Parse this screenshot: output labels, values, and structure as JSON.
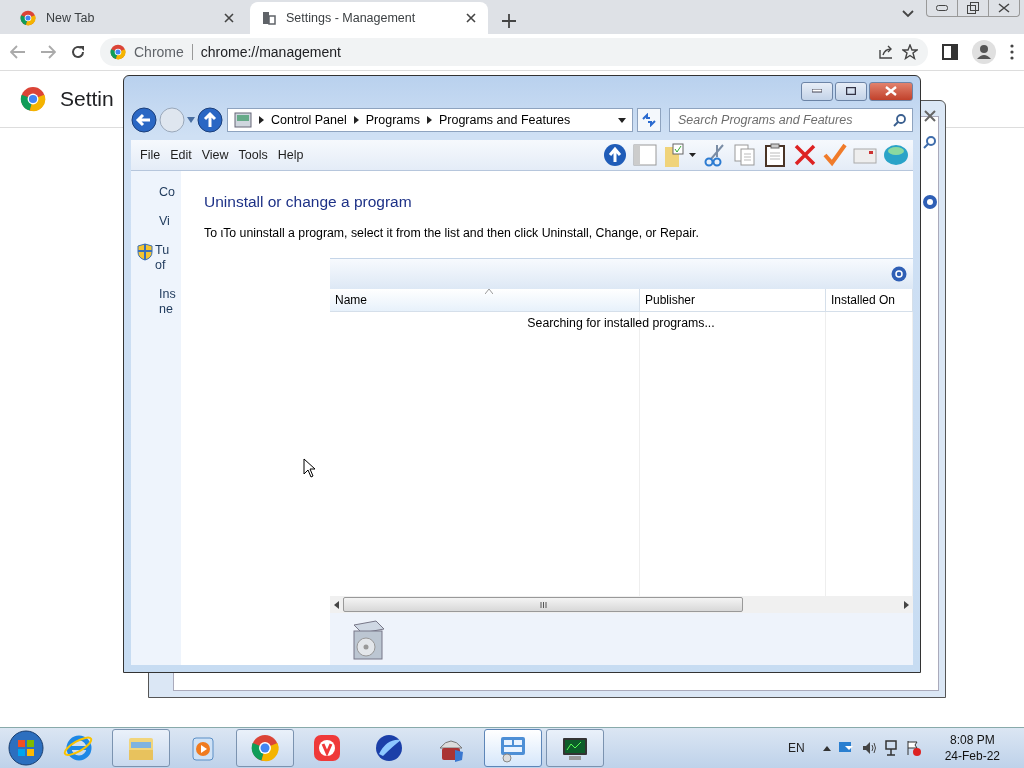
{
  "browser": {
    "tabs": [
      {
        "title": "New Tab",
        "selected": false
      },
      {
        "title": "Settings - Management",
        "selected": true
      }
    ],
    "omnibox": {
      "site": "Chrome",
      "url": "chrome://management"
    },
    "page_heading": "Settin"
  },
  "explorer": {
    "breadcrumb": [
      "Control Panel",
      "Programs",
      "Programs and Features"
    ],
    "search": {
      "placeholder": "Search Programs and Features"
    },
    "menu": [
      "File",
      "Edit",
      "View",
      "Tools",
      "Help"
    ],
    "sidebar": [
      {
        "kind": "link",
        "lines": [
          "Co"
        ]
      },
      {
        "kind": "link",
        "lines": [
          "Vi"
        ]
      },
      {
        "kind": "shield",
        "lines": [
          "Tu",
          "of"
        ]
      },
      {
        "kind": "link",
        "lines": [
          "Ins",
          "ne"
        ]
      }
    ],
    "heading": "Uninstall or change a program",
    "description": "To ιTo uninstall a program, select it from the list and then click Uninstall, Change, or Repair.",
    "columns": [
      "Name",
      "Publisher",
      "Installed On"
    ],
    "status": "Searching for installed programs..."
  },
  "taskbar": {
    "apps": [
      {
        "kind": "ie",
        "running": false,
        "selected": false
      },
      {
        "kind": "folder",
        "running": true,
        "selected": false
      },
      {
        "kind": "media",
        "running": false,
        "selected": false
      },
      {
        "kind": "chrome",
        "running": true,
        "selected": false
      },
      {
        "kind": "vivaldi",
        "running": false,
        "selected": false
      },
      {
        "kind": "bird",
        "running": false,
        "selected": false
      },
      {
        "kind": "installer",
        "running": false,
        "selected": false
      },
      {
        "kind": "control-panel",
        "running": true,
        "selected": true
      },
      {
        "kind": "monitor",
        "running": true,
        "selected": false
      }
    ],
    "language": "EN",
    "time": "8:08 PM",
    "date": "24-Feb-22"
  }
}
